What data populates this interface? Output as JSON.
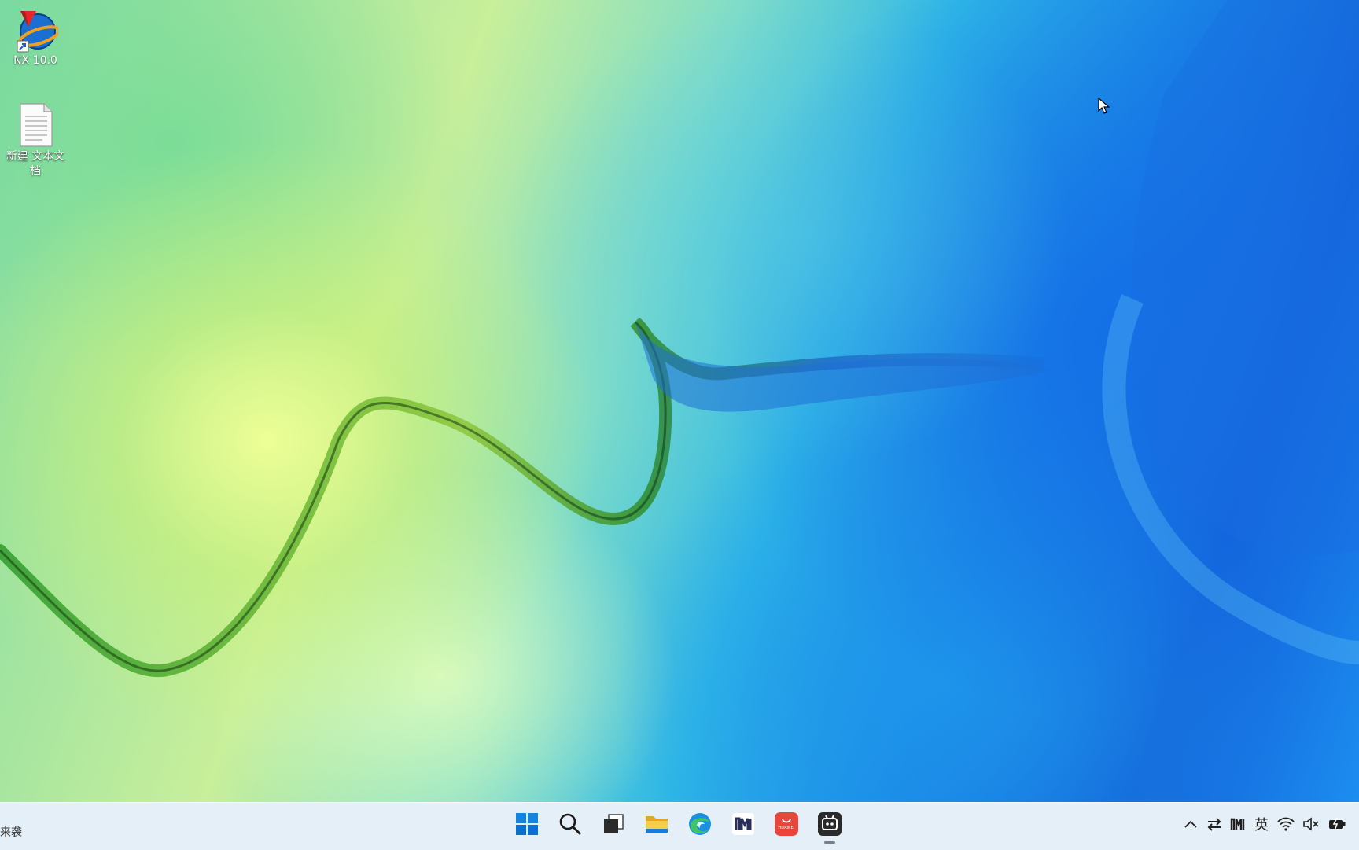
{
  "desktop": {
    "icons": [
      {
        "label": "NX 10.0",
        "icon": "nx-app-icon"
      },
      {
        "label": "新建 文本文档",
        "icon": "text-document-icon"
      }
    ]
  },
  "taskbar": {
    "left_text": "来袭",
    "apps": [
      {
        "name": "start-button",
        "icon": "windows-logo-icon"
      },
      {
        "name": "search-button",
        "icon": "search-icon"
      },
      {
        "name": "task-view-button",
        "icon": "task-view-icon"
      },
      {
        "name": "file-explorer-button",
        "icon": "folder-icon"
      },
      {
        "name": "edge-button",
        "icon": "edge-icon"
      },
      {
        "name": "app-m-button",
        "icon": "m-logo-icon"
      },
      {
        "name": "huawei-store-button",
        "icon": "huawei-appgallery-icon",
        "label": "HUAWEI"
      },
      {
        "name": "active-app-button",
        "icon": "screen-recorder-icon"
      }
    ],
    "tray": {
      "chevron": "^",
      "input_language": "英"
    }
  },
  "colors": {
    "taskbar_bg": "#e2eef6",
    "start_blue": "#0f78d4",
    "folder_yellow": "#f3c33a",
    "huawei_red": "#e8463a"
  }
}
